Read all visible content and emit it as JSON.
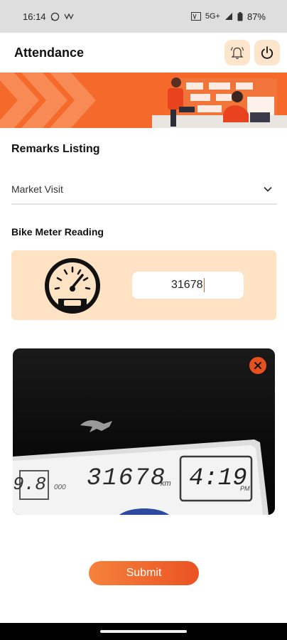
{
  "status_bar": {
    "time": "16:14",
    "network": "5G+",
    "battery": "87%"
  },
  "app_bar": {
    "title": "Attendance",
    "actions": [
      "bell-icon",
      "power-icon"
    ]
  },
  "remarks": {
    "label": "Remarks Listing",
    "selected": "Market Visit"
  },
  "bike_meter": {
    "label": "Bike Meter Reading",
    "value": "31678"
  },
  "photo": {
    "odometer_text": "31678",
    "odometer_unit": "km",
    "clock_text": "4:19",
    "clock_suffix": "PM",
    "trip_text": "9.8",
    "trip_unit": "000"
  },
  "submit": {
    "label": "Submit"
  },
  "colors": {
    "accent": "#f56a2a",
    "card_bg": "#fde2c4",
    "icon_bg": "#fde5cc",
    "close": "#e8501f"
  }
}
